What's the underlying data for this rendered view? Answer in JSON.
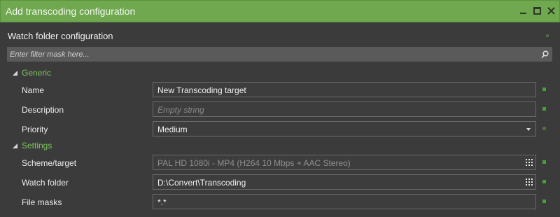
{
  "window": {
    "title": "Add transcoding configuration"
  },
  "header": {
    "label": "Watch folder configuration"
  },
  "filter": {
    "placeholder": "Enter filter mask here..."
  },
  "sections": [
    {
      "title": "Generic",
      "rows": [
        {
          "label": "Name",
          "value": "New Transcoding target"
        },
        {
          "label": "Description",
          "placeholder": "Empty string"
        },
        {
          "label": "Priority",
          "value": "Medium"
        }
      ]
    },
    {
      "title": "Settings",
      "rows": [
        {
          "label": "Scheme/target",
          "value": "PAL HD 1080i - MP4 (H264 10 Mbps + AAC Stereo)"
        },
        {
          "label": "Watch folder",
          "value": "D:\\Convert\\Transcoding"
        },
        {
          "label": "File masks",
          "value": "*.*"
        }
      ]
    }
  ],
  "colors": {
    "titlebar": "#6fa84f",
    "section_title": "#7ec460",
    "status_valid": "#3fa532"
  }
}
